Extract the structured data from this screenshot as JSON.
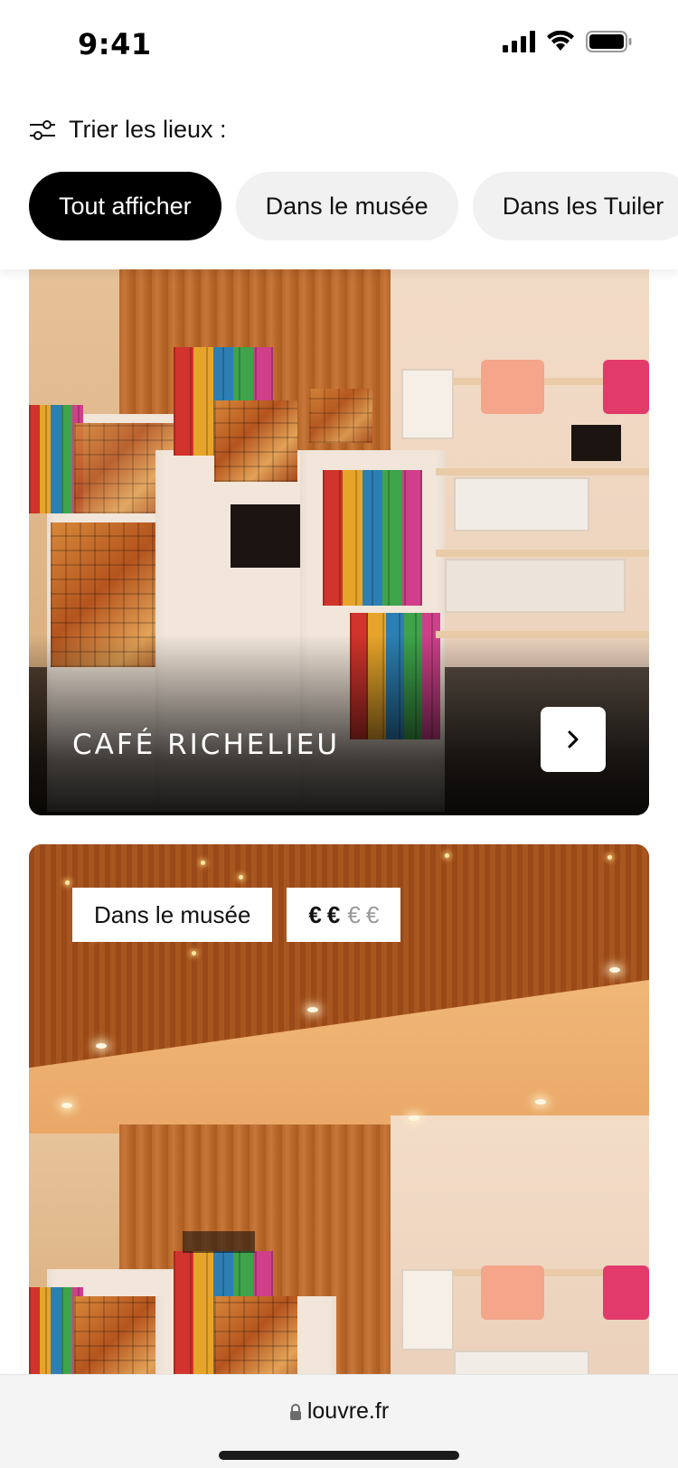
{
  "status_bar": {
    "time": "9:41",
    "icons": [
      "cellular-signal-icon",
      "wifi-icon",
      "battery-icon"
    ]
  },
  "sort": {
    "icon": "sliders-icon",
    "label": "Trier les lieux :",
    "chips": [
      {
        "label": "Tout afficher",
        "active": true
      },
      {
        "label": "Dans le musée",
        "active": false
      },
      {
        "label": "Dans les Tuiler",
        "active": false
      }
    ]
  },
  "cards": [
    {
      "title": "CAFÉ RICHELIEU",
      "arrow_icon": "chevron-right-icon"
    },
    {
      "badge_location": "Dans le musée",
      "price": {
        "strong": [
          "€",
          "€"
        ],
        "dim": [
          "€",
          "€"
        ]
      }
    }
  ],
  "browser": {
    "lock_icon": "lock-icon",
    "url": "louvre.fr"
  },
  "colors": {
    "chip_active_bg": "#000000",
    "chip_inactive_bg": "#f1f1f1",
    "url_bar_bg": "#f4f4f4"
  }
}
